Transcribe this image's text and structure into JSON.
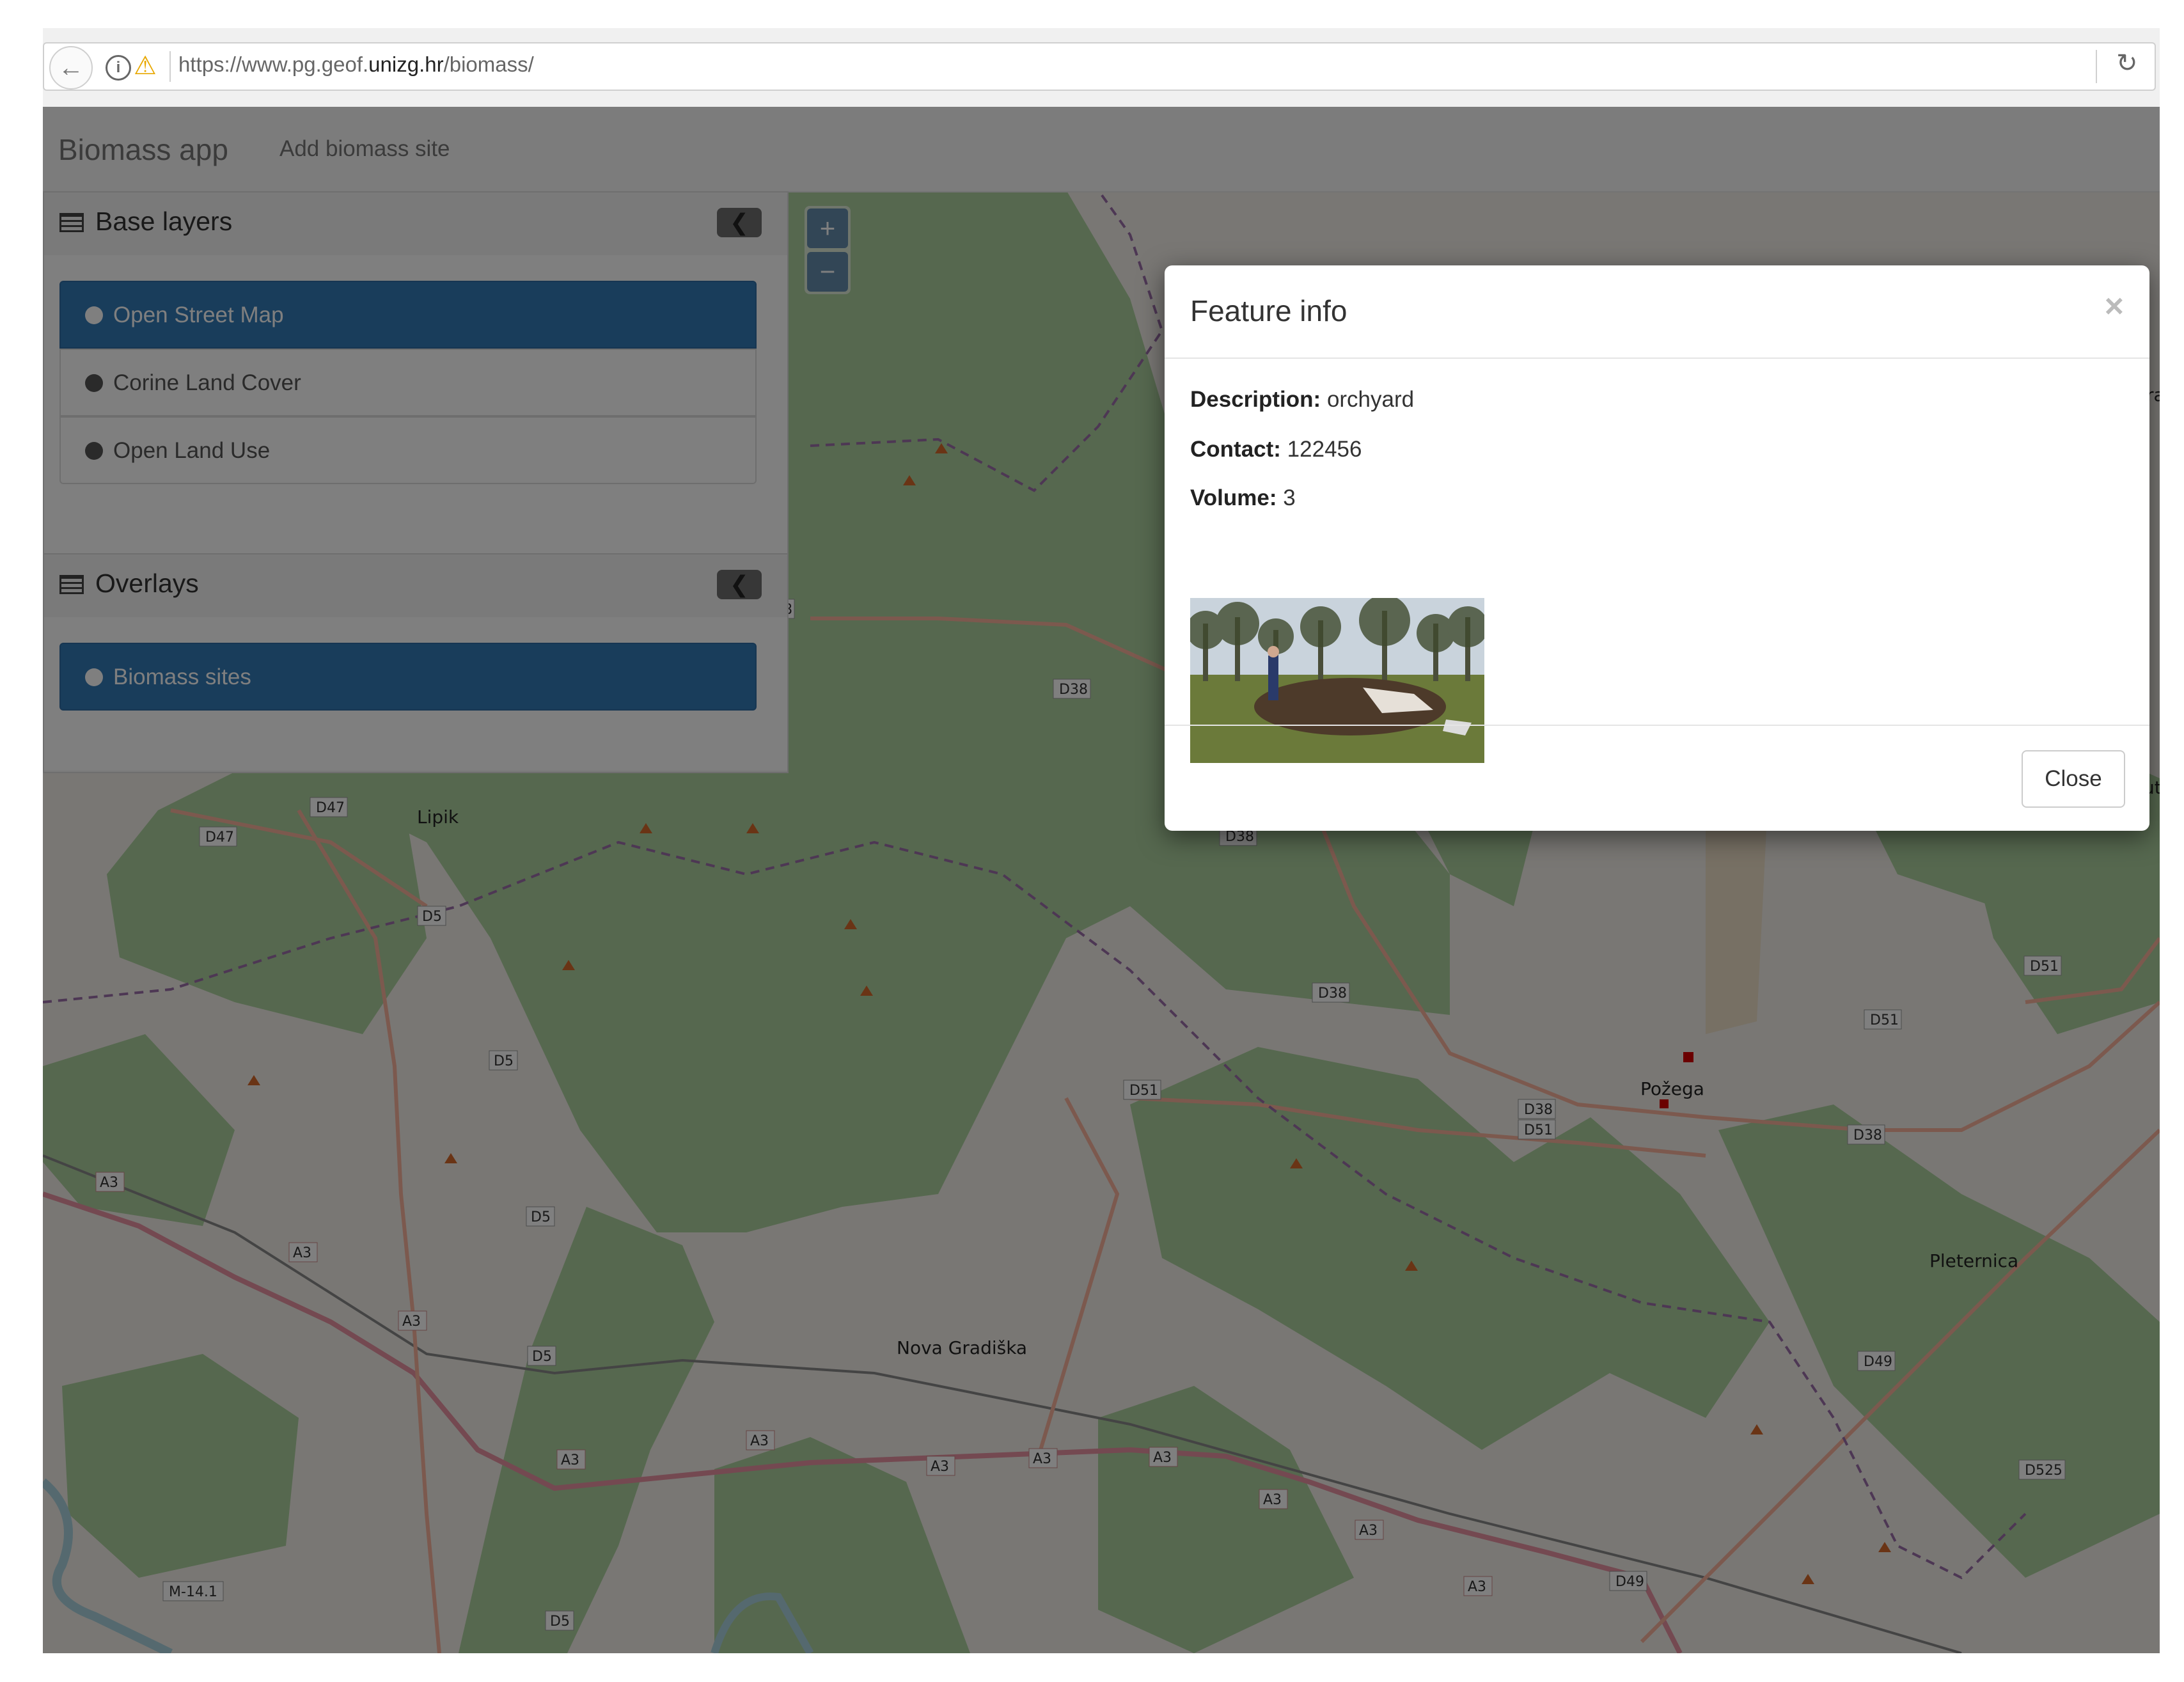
{
  "browser": {
    "url_prefix": "https://www.pg.geof.",
    "url_domain": "unizg.hr",
    "url_suffix": "/biomass/"
  },
  "navbar": {
    "brand": "Biomass app",
    "add_link": "Add biomass site"
  },
  "base_layers": {
    "title": "Base layers",
    "items": [
      {
        "label": "Open Street Map",
        "active": true
      },
      {
        "label": "Corine Land Cover",
        "active": false
      },
      {
        "label": "Open Land Use",
        "active": false
      }
    ]
  },
  "overlays": {
    "title": "Overlays",
    "items": [
      {
        "label": "Biomass sites",
        "active": true
      }
    ]
  },
  "zoom": {
    "in": "+",
    "out": "−"
  },
  "modal": {
    "title": "Feature info",
    "close_x": "×",
    "fields": [
      {
        "label": "Description:",
        "value": "orchyard"
      },
      {
        "label": "Contact:",
        "value": "122456"
      },
      {
        "label": "Volume:",
        "value": "3"
      }
    ],
    "close_button": "Close"
  },
  "map": {
    "towns": [
      "Lipik",
      "Nova Gradiška",
      "Požega",
      "Pleternica",
      "Kut",
      "Ora"
    ],
    "road_labels": [
      "D47",
      "D47",
      "D5",
      "D5",
      "D5",
      "D5",
      "D5",
      "D38",
      "D38",
      "D38",
      "D38",
      "D38",
      "D51",
      "D51",
      "D51",
      "D51",
      "D49",
      "D49",
      "D525",
      "A3",
      "A3",
      "A3",
      "A3",
      "A3",
      "A3",
      "A3",
      "A3",
      "A3",
      "A3",
      "A3",
      "M-14.1",
      "8"
    ]
  },
  "colors": {
    "primary": "#337ab7",
    "forest": "#add19e",
    "land": "#f2efe9",
    "motorway": "#e892a2",
    "trunk": "#f9b29c"
  }
}
